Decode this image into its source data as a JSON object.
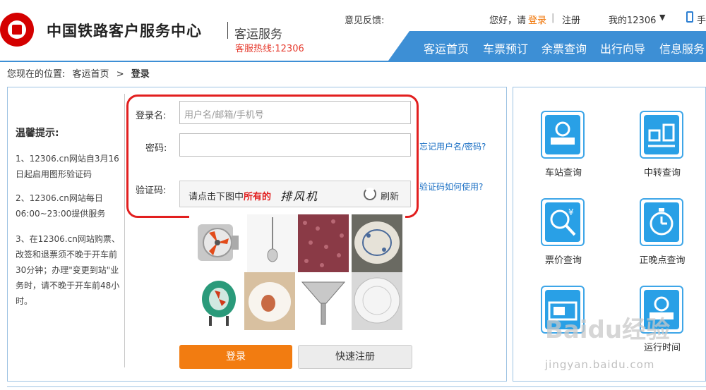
{
  "header": {
    "brand": "中国铁路客户服务中心",
    "brand_sub": "客运服务",
    "hotline": "客服热线:12306",
    "feedback_label": "意见反馈:",
    "hello": "您好，请",
    "login_link": "登录",
    "separator": "|",
    "register_link": "注册",
    "my_account": "我的12306",
    "my_account_caret": "▼",
    "mobile_label": "手",
    "nav": [
      "客运首页",
      "车票预订",
      "余票查询",
      "出行向导",
      "信息服务"
    ]
  },
  "breadcrumb": {
    "prefix": "您现在的位置:",
    "home": "客运首页",
    "sep": ">",
    "current": "登录"
  },
  "tips": {
    "title": "温馨提示:",
    "items": [
      "1、12306.cn网站自3月16日起启用图形验证码",
      "2、12306.cn网站每日06:00~23:00提供服务",
      "3、在12306.cn网站购票、改签和退票须不晚于开车前30分钟；办理\"变更到站\"业务时，请不晚于开车前48小时。"
    ]
  },
  "form": {
    "username_label": "登录名:",
    "username_placeholder": "用户名/邮箱/手机号",
    "password_label": "密码:",
    "captcha_label": "验证码:",
    "forgot_link": "忘记用户名/密码?",
    "captcha_help": "验证码如何使用?",
    "captcha_prompt_pre": "请点击下图中",
    "captcha_prompt_highlight": "所有的",
    "captcha_word": "排风机",
    "refresh_label": "刷新",
    "login_button": "登录",
    "register_button": "快速注册"
  },
  "captcha_images": [
    {
      "name": "exhaust-fan",
      "color": "#c8c8c8"
    },
    {
      "name": "toilet-brush",
      "color": "#eeeeee"
    },
    {
      "name": "red-beans",
      "color": "#8a3a46"
    },
    {
      "name": "porcelain-plate",
      "color": "#d8d4cc"
    },
    {
      "name": "axial-fan",
      "color": "#2a9a7a"
    },
    {
      "name": "food-plate",
      "color": "#e8d8c8"
    },
    {
      "name": "steel-funnel",
      "color": "#bfbfbf"
    },
    {
      "name": "white-plate",
      "color": "#e6e6e6"
    }
  ],
  "services": [
    {
      "label": "车站查询",
      "icon": "station-icon"
    },
    {
      "label": "中转查询",
      "icon": "transfer-icon"
    },
    {
      "label": "票价查询",
      "icon": "fare-icon"
    },
    {
      "label": "正晚点查询",
      "icon": "clock-icon"
    },
    {
      "label": "",
      "icon": "ticket-icon"
    },
    {
      "label": "运行时间",
      "icon": "train-icon"
    }
  ],
  "watermark": {
    "brand": "Baidu经验",
    "url": "jingyan.baidu.com"
  },
  "colors": {
    "nav_blue": "#3d8fd5",
    "login_orange": "#f27c11",
    "accent_red": "#e21f1f",
    "icon_blue": "#29a0e6",
    "link_blue": "#1a6fc4"
  }
}
